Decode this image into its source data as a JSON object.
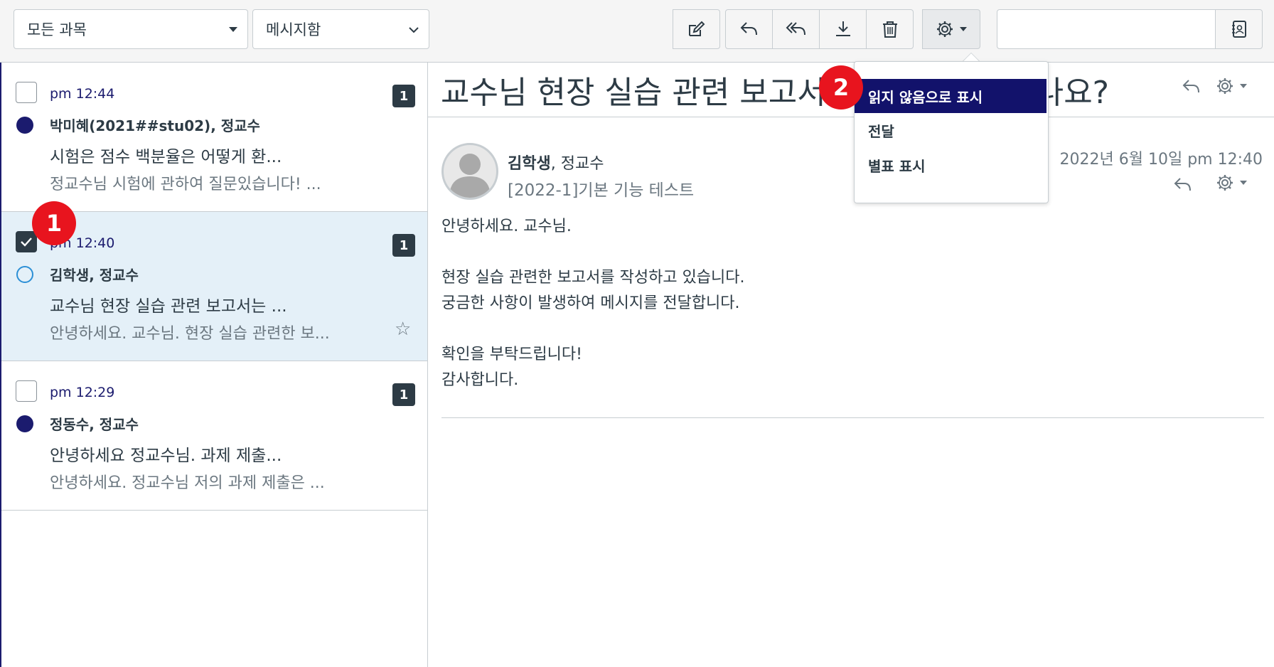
{
  "toolbar": {
    "course_select": "모든 과목",
    "mailbox_select": "메시지함",
    "search_value": ""
  },
  "messages": [
    {
      "time": "pm 12:44",
      "count": "1",
      "from": "박미혜(2021##stu02), 정교수",
      "subject": "시험은 점수 백분율은 어떻게 환...",
      "preview": "정교수님 시험에 관하여 질문있습니다! ..."
    },
    {
      "time": "pm 12:40",
      "count": "1",
      "from": "김학생, 정교수",
      "subject": "교수님 현장 실습 관련 보고서는 ...",
      "preview": "안녕하세요. 교수님. 현장 실습 관련한 보...",
      "star": "☆"
    },
    {
      "time": "pm 12:29",
      "count": "1",
      "from": "정동수, 정교수",
      "subject": "안녕하세요 정교수님. 과제 제출...",
      "preview": "안녕하세요. 정교수님 저의 과제 제출은 ..."
    }
  ],
  "markers": {
    "one": "1",
    "two": "2"
  },
  "detail": {
    "title_left": "교수님 현장 실습 관련 보고서",
    "title_right": "나요?",
    "sender_name": "김학생",
    "sender_rest": ", 정교수",
    "context": "[2022-1]기본 기능 테스트",
    "date": "2022년 6월 10일 pm 12:40",
    "body": [
      "안녕하세요. 교수님.",
      "",
      "현장 실습 관련한 보고서를 작성하고 있습니다.",
      "궁금한 사항이 발생하여 메시지를 전달합니다.",
      "",
      "확인을 부탁드립니다!",
      "감사합니다."
    ]
  },
  "menu": {
    "items": [
      "읽지 않음으로 표시",
      "전달",
      "별표 표시"
    ]
  }
}
